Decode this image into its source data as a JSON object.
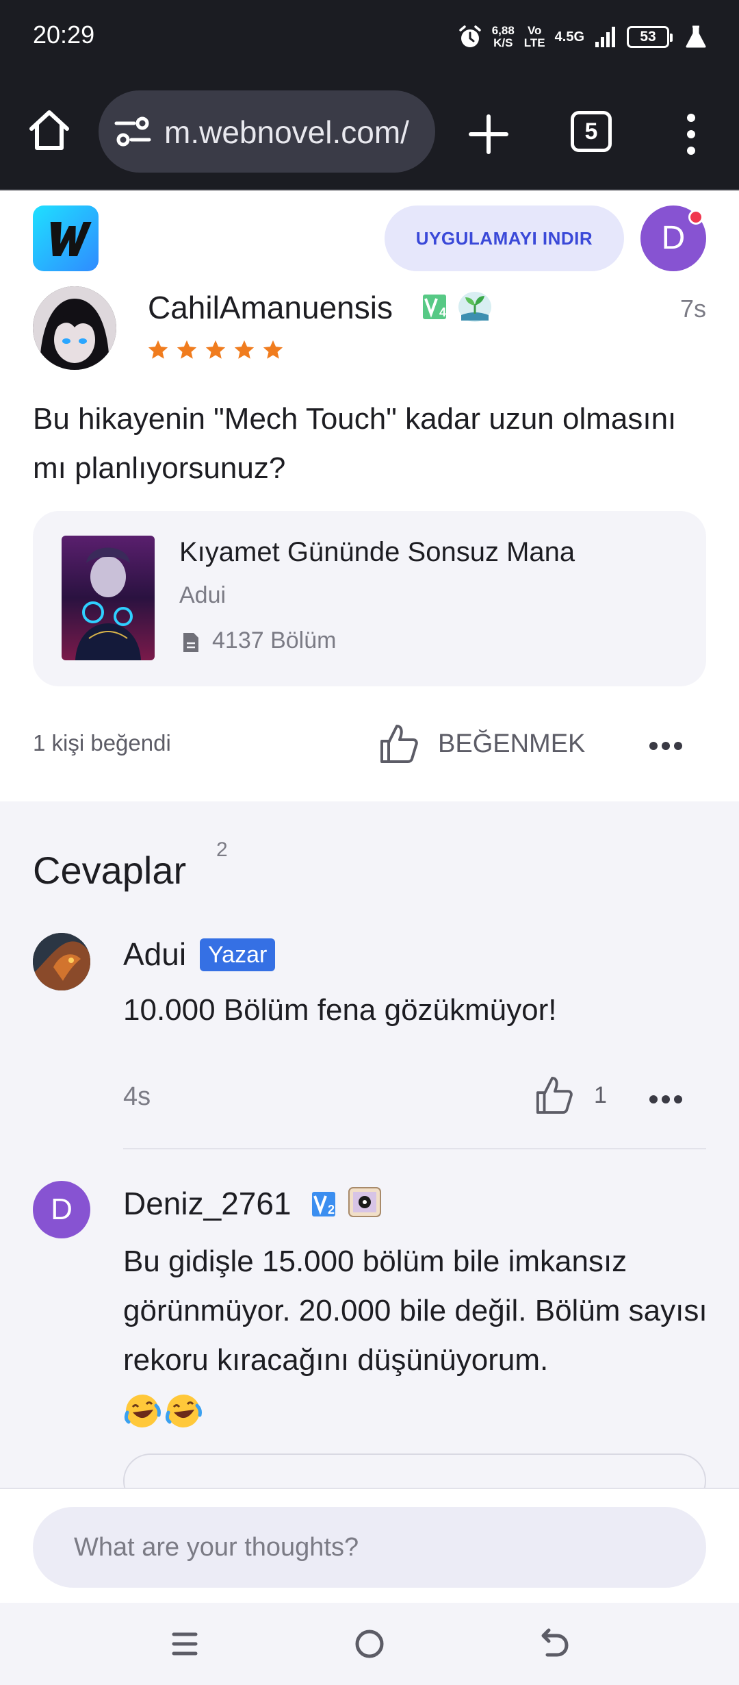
{
  "status_bar": {
    "time": "20:29",
    "net_speed": "6,88",
    "net_unit": "K/S",
    "volte_top": "Vo",
    "volte_bottom": "LTE",
    "network": "4.5G",
    "battery": "53"
  },
  "browser": {
    "url": "m.webnovel.com/",
    "tab_count": "5"
  },
  "header": {
    "logo_letter": "W",
    "download_label": "UYGULAMAYI INDIR",
    "user_initial": "D"
  },
  "comment": {
    "author": "CahilAmanuensis",
    "level_badge": "4",
    "time": "7s",
    "rating": 5,
    "body": "Bu hikayenin \"Mech Touch\" kadar uzun olmasını mı planlıyorsunuz?",
    "book": {
      "title": "Kıyamet Gününde Sonsuz Mana",
      "author": "Adui",
      "chapters": "4137 Bölüm"
    },
    "likes_text": "1 kişi beğendi",
    "like_label": "BEĞENMEK"
  },
  "replies": {
    "title": "Cevaplar",
    "count": "2",
    "items": [
      {
        "author": "Adui",
        "badge": "Yazar",
        "body": "10.000 Bölüm fena gözükmüyor!",
        "time": "4s",
        "likes": "1"
      },
      {
        "author": "Deniz_2761",
        "initial": "D",
        "level_badge": "2",
        "body": "Bu gidişle 15.000 bölüm bile imkansız görünmüyor. 20.000 bile değil. Bölüm sayısı rekoru kıracağını düşünüyorum.",
        "emoji": "🤣🤣"
      }
    ]
  },
  "composer": {
    "placeholder": "What are your thoughts?"
  },
  "colors": {
    "accent": "#3a49d8",
    "author_badge": "#3570e4",
    "avatar_purple": "#8753d2",
    "star": "#f07c1e",
    "notification": "#f0364f"
  },
  "icons": [
    "alarm-icon",
    "signal-icon",
    "battery-icon",
    "flask-icon",
    "home-icon",
    "tune-icon",
    "plus-icon",
    "tabs-icon",
    "overflow-menu-icon",
    "star-icon",
    "level-badge-icon",
    "sprout-badge-icon",
    "document-icon",
    "thumbs-up-icon",
    "more-dots-icon",
    "eye-badge-icon",
    "recent-apps-icon",
    "home-circle-icon",
    "back-icon"
  ]
}
